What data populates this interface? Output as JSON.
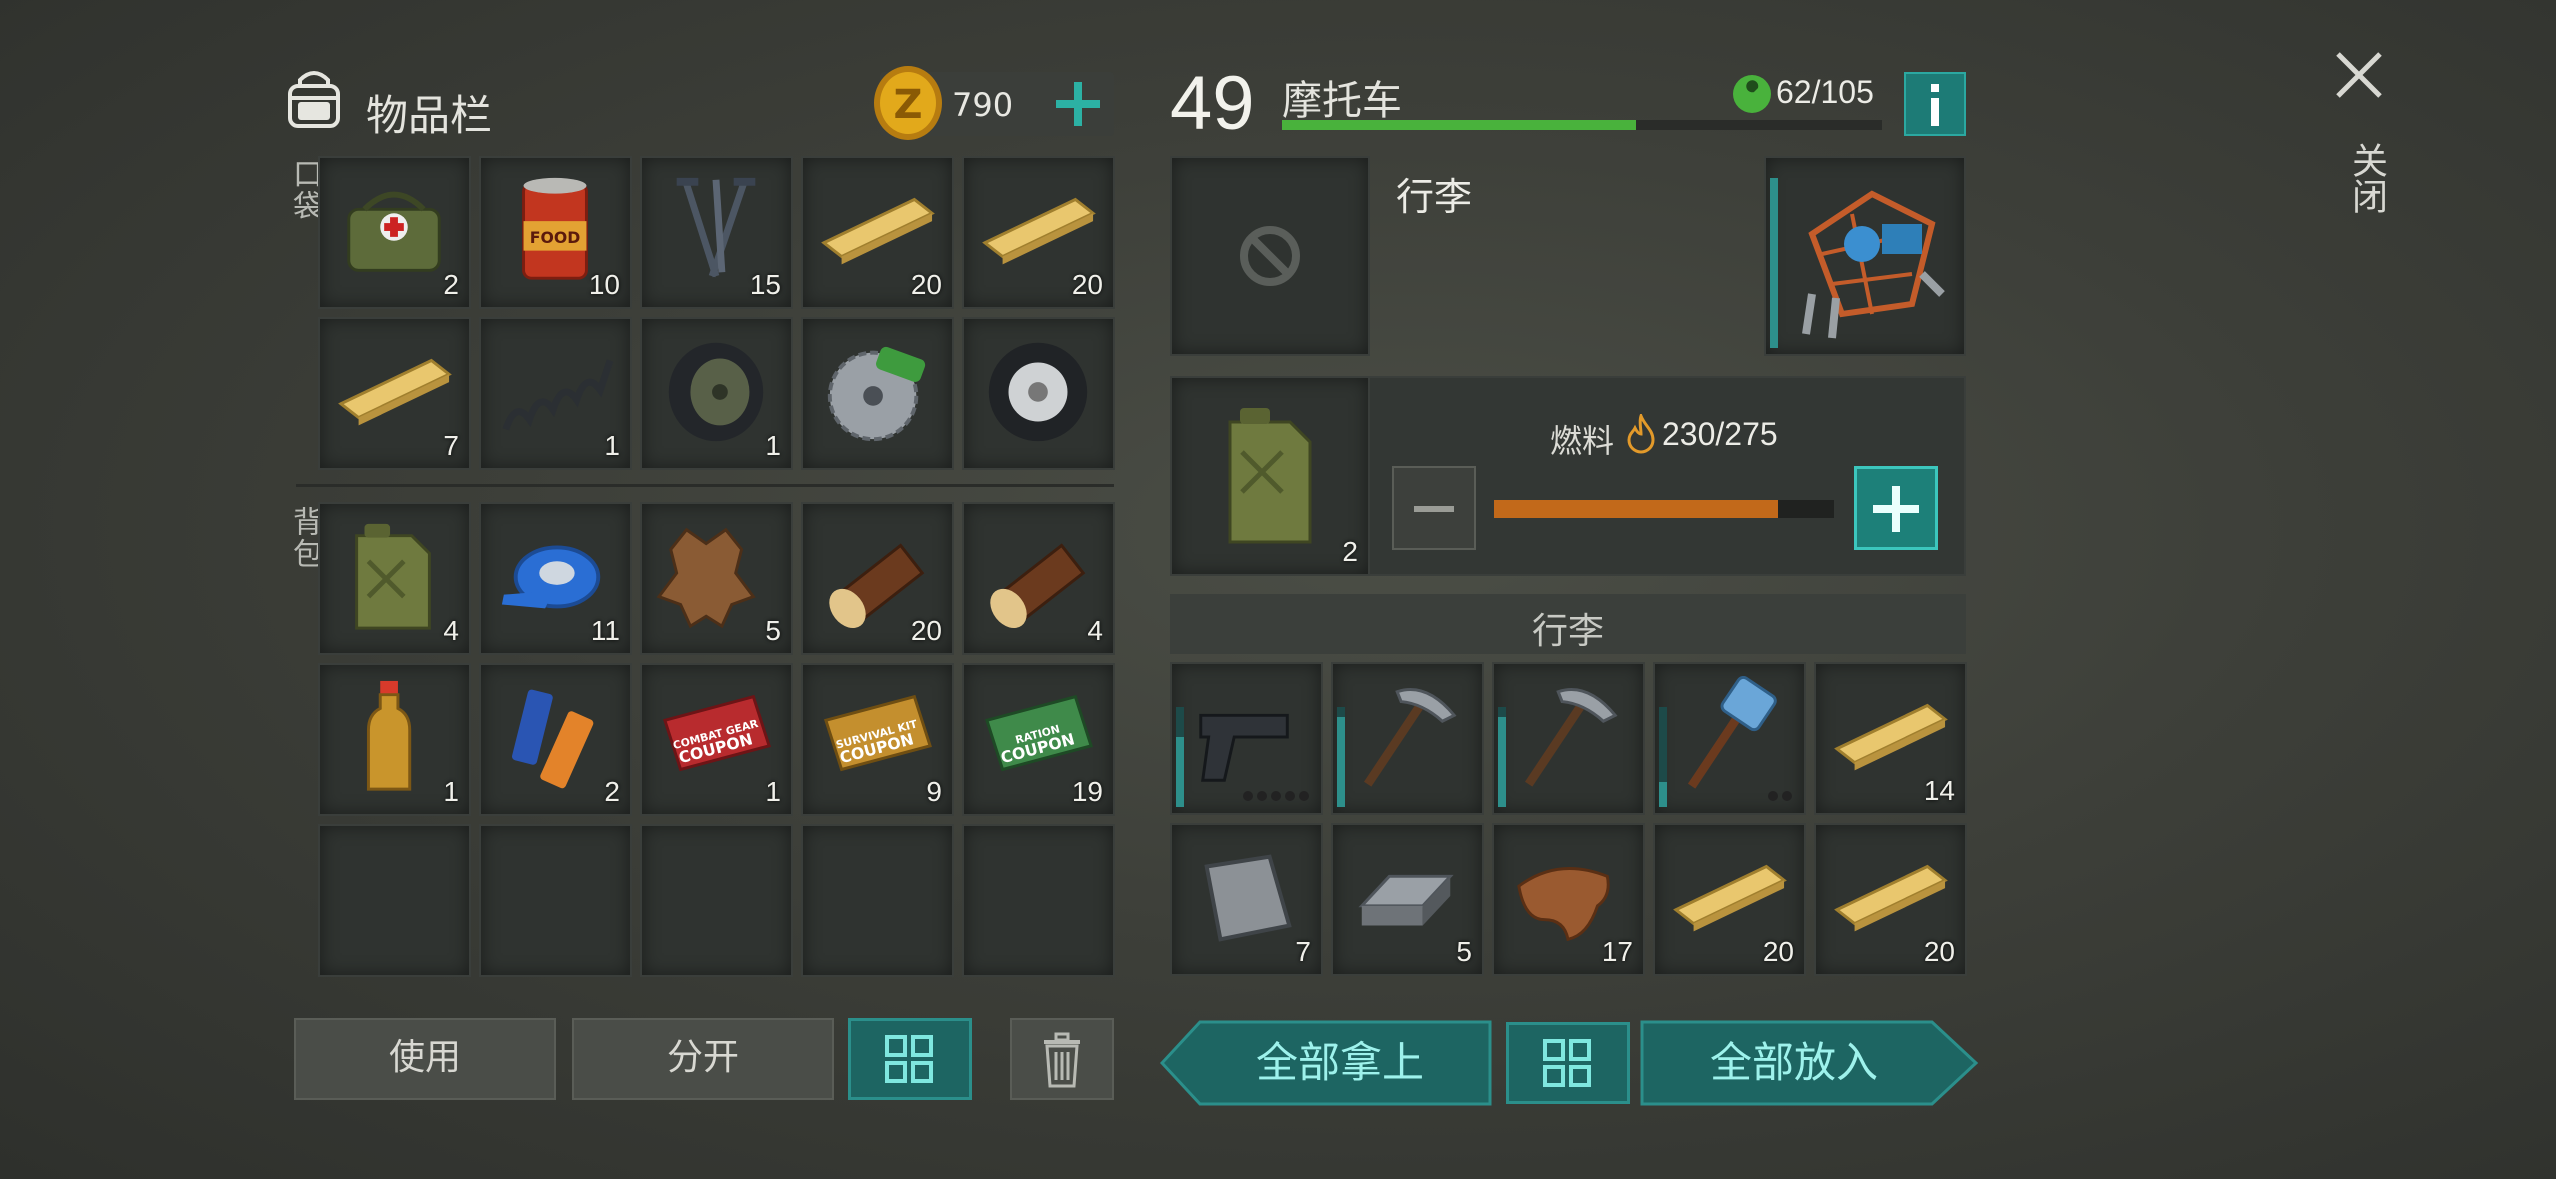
{
  "inventory": {
    "title": "物品栏",
    "coins": "790",
    "pockets_label": "口袋",
    "backpack_label": "背包",
    "pocket_slots": [
      {
        "item": "first-aid-bag",
        "count": "2"
      },
      {
        "item": "canned-food",
        "count": "10"
      },
      {
        "item": "nails",
        "count": "15"
      },
      {
        "item": "wooden-plank",
        "count": "20"
      },
      {
        "item": "wooden-plank",
        "count": "20"
      },
      {
        "item": "wooden-plank",
        "count": "7"
      },
      {
        "item": "spring",
        "count": "1"
      },
      {
        "item": "wheel",
        "count": "1"
      },
      {
        "item": "circular-saw-blade",
        "count": ""
      },
      {
        "item": "tire",
        "count": ""
      }
    ],
    "backpack_slots": [
      {
        "item": "jerry-can",
        "count": "4"
      },
      {
        "item": "duct-tape",
        "count": "11"
      },
      {
        "item": "animal-hide",
        "count": "5"
      },
      {
        "item": "log",
        "count": "20"
      },
      {
        "item": "log",
        "count": "4"
      },
      {
        "item": "bottle",
        "count": "1"
      },
      {
        "item": "batteries",
        "count": "2"
      },
      {
        "item": "combat-gear-coupon",
        "count": "1",
        "text": "COMBAT GEAR COUPON"
      },
      {
        "item": "survival-kit-coupon",
        "count": "9",
        "text": "SURVIVAL KIT COUPON"
      },
      {
        "item": "ration-coupon",
        "count": "19",
        "text": "RATION COUPON"
      },
      {
        "item": "empty",
        "count": ""
      },
      {
        "item": "empty",
        "count": ""
      },
      {
        "item": "empty",
        "count": ""
      },
      {
        "item": "empty",
        "count": ""
      },
      {
        "item": "empty",
        "count": ""
      }
    ],
    "buttons": {
      "use": "使用",
      "split": "分开"
    }
  },
  "vehicle": {
    "level": "49",
    "name": "摩托车",
    "durability": "62/105",
    "durability_fraction": 0.59,
    "luggage_title": "行李",
    "fuel_label": "燃料",
    "fuel_value": "230/275",
    "fuel_fraction": 0.836,
    "jerry_can_count": "2",
    "storage_header": "行李",
    "storage_slots": [
      {
        "item": "pistol",
        "count": "",
        "dur": 0.7,
        "dots": 5
      },
      {
        "item": "pickaxe",
        "count": "",
        "dur": 0.9
      },
      {
        "item": "pickaxe",
        "count": "",
        "dur": 0.9
      },
      {
        "item": "sledgehammer",
        "count": "",
        "dur": 0.25,
        "dots": 2
      },
      {
        "item": "wooden-plank",
        "count": "14"
      },
      {
        "item": "iron-plate",
        "count": "7"
      },
      {
        "item": "iron-ingot",
        "count": "5"
      },
      {
        "item": "leather",
        "count": "17"
      },
      {
        "item": "wooden-plank",
        "count": "20"
      },
      {
        "item": "wooden-plank",
        "count": "20"
      }
    ],
    "buttons": {
      "take_all": "全部拿上",
      "put_all": "全部放入"
    }
  },
  "close_label": "关闭",
  "colors": {
    "teal": "#1d6562",
    "teal_border": "#2b8f8b",
    "green_bar": "#49b23c",
    "fuel_bar": "#c2691a",
    "coin": "#e2a91b"
  }
}
